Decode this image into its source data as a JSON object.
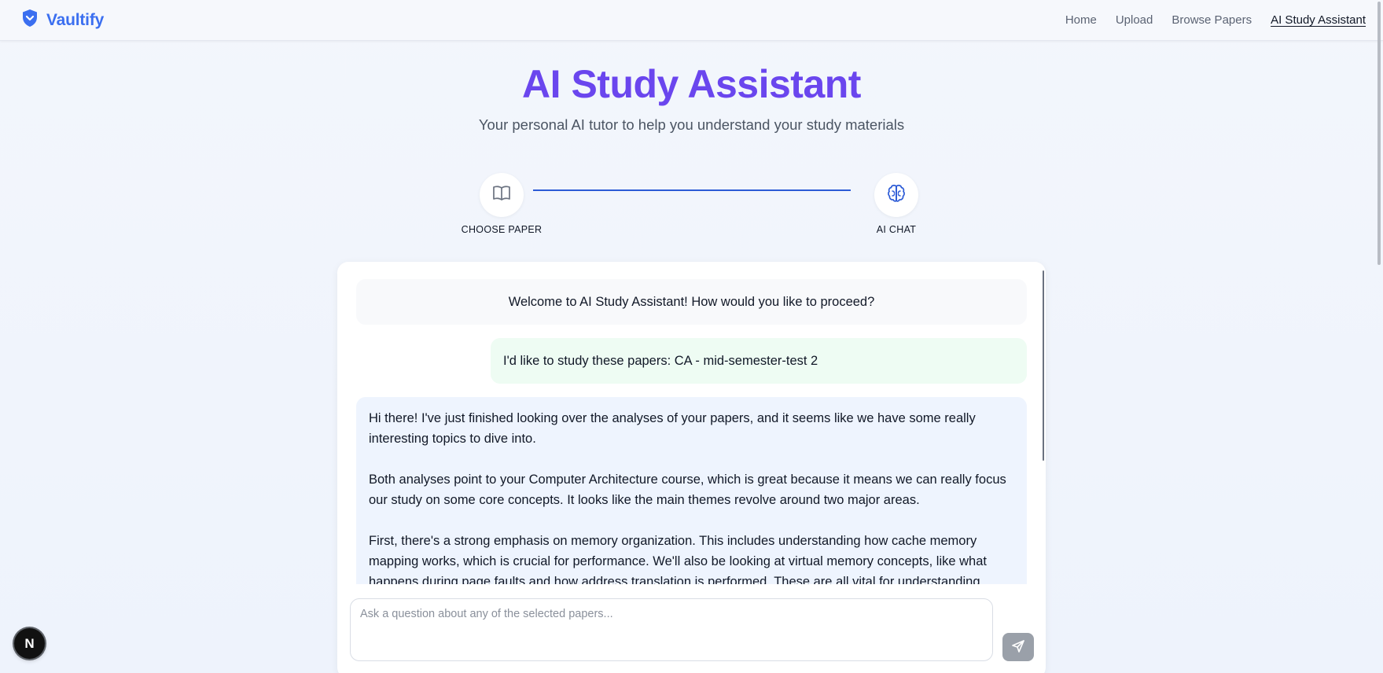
{
  "nav": {
    "brand": "Vaultify",
    "links": [
      "Home",
      "Upload",
      "Browse Papers",
      "AI Study Assistant"
    ],
    "active": "AI Study Assistant"
  },
  "hero": {
    "title": "AI Study Assistant",
    "subtitle": "Your personal AI tutor to help you understand your study materials"
  },
  "stepper": {
    "steps": [
      {
        "label": "CHOOSE PAPER",
        "icon": "book-open-icon"
      },
      {
        "label": "AI CHAT",
        "icon": "brain-icon"
      }
    ]
  },
  "chat": {
    "system_message": "Welcome to AI Study Assistant! How would you like to proceed?",
    "user_message": "I'd like to study these papers: CA - mid-semester-test 2",
    "ai_paragraphs": [
      "Hi there! I've just finished looking over the analyses of your papers, and it seems like we have some really interesting topics to dive into.",
      "Both analyses point to your Computer Architecture course, which is great because it means we can really focus our study on some core concepts. It looks like the main themes revolve around two major areas.",
      "First, there's a strong emphasis on memory organization. This includes understanding how cache memory mapping works, which is crucial for performance. We'll also be looking at virtual memory concepts, like what happens during page faults and how address translation is performed. These are all vital for understanding"
    ],
    "input_placeholder": "Ask a question about any of the selected papers...",
    "input_value": ""
  },
  "badge": {
    "letter": "N"
  },
  "colors": {
    "brand": "#3b6ff0",
    "title": "#6a46ee",
    "step_line": "#2c5bd6",
    "user_bubble": "#eefcf3",
    "ai_bubble": "#eef4fe"
  }
}
